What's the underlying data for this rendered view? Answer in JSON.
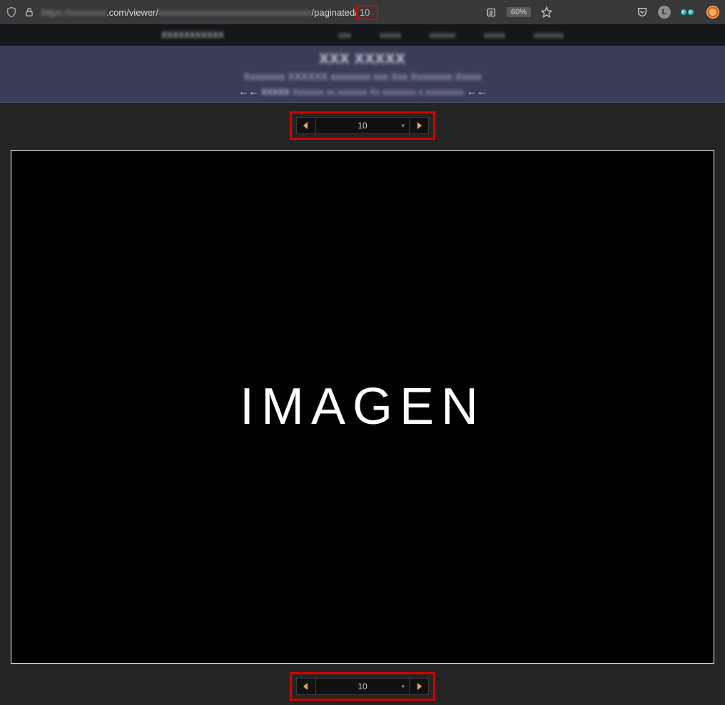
{
  "addressbar": {
    "url_prefix_blur": "https://xxxxxxxx",
    "url_mid": ".com/viewer/",
    "url_mid_blur": "xxxxxxxxxxxxxxxxxxxxxxxxxxxxxxxxx",
    "url_tail": "/paginated/",
    "url_page": "10",
    "zoom": "60%"
  },
  "nav": {
    "brand": "XXXXXXXXXXX",
    "items": [
      "xxx",
      "xxxxx",
      "xxxxxx",
      "xxxxx",
      "xxxxxxx"
    ]
  },
  "banner": {
    "title": "XXX XXXXX",
    "subtitle": "Xxxxxxxx  XXXXXX  xxxxxxxx xxx  Xxx Xxxxxxxx Xxxxx",
    "mode_label": "XXXXX",
    "mode_text": "Xxxxxxx xx xxxxxxx  Xx xxxxxxxx x xxxxxxxxx",
    "arrows": "←←"
  },
  "pager": {
    "value": "10"
  },
  "image": {
    "placeholder": "IMAGEN"
  },
  "avatar": {
    "letter": "L"
  }
}
